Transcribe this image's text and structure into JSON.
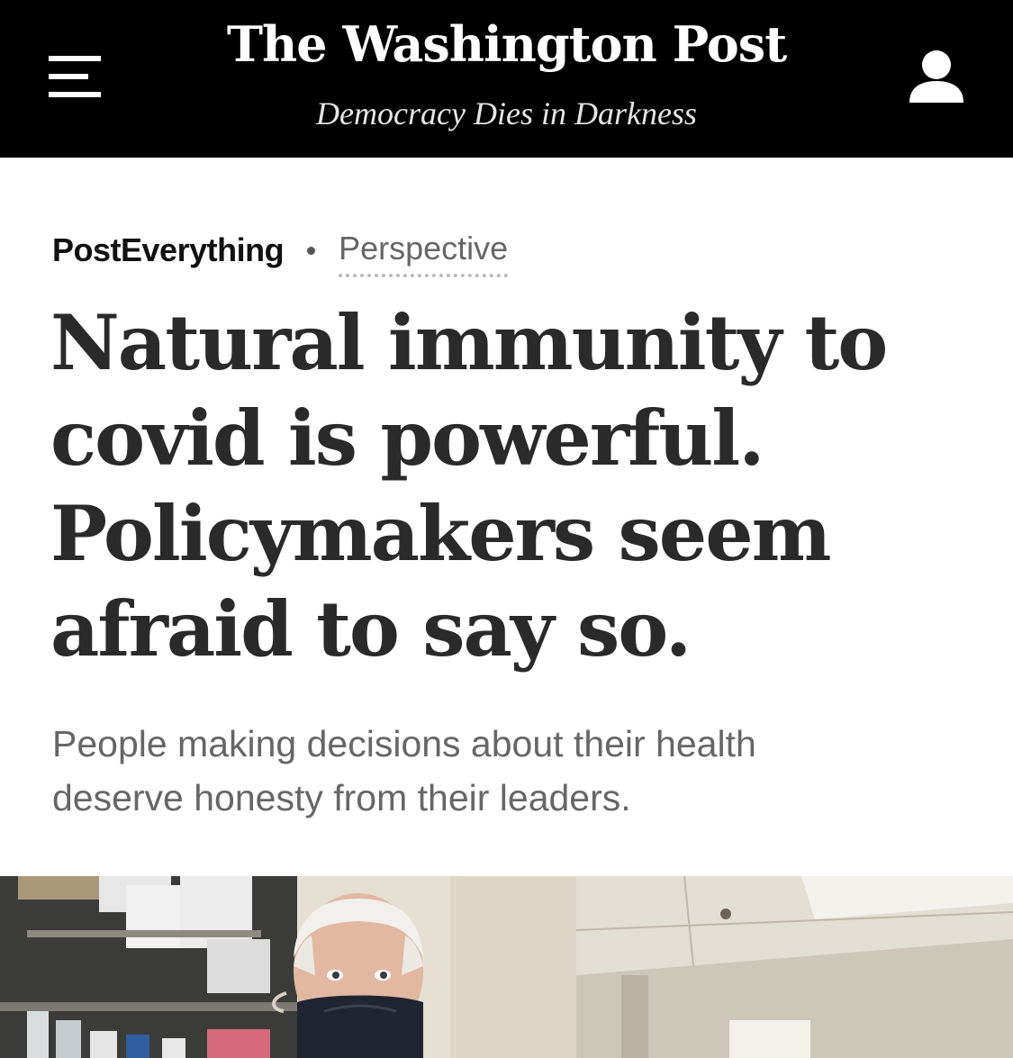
{
  "header": {
    "logo": "The Washington Post",
    "tagline": "Democracy Dies in Darkness",
    "menu_icon": "hamburger-menu-icon",
    "account_icon": "user-account-icon"
  },
  "article": {
    "section": "PostEverything",
    "label": "Perspective",
    "headline_lines": [
      "Natural immunity to",
      "covid is powerful.",
      "Policymakers seem",
      "afraid to say so."
    ],
    "subheadline_lines": [
      "People making decisions about their health",
      "deserve honesty from their leaders."
    ]
  },
  "colors": {
    "masthead_bg": "#000000",
    "headline": "#2a2a2a",
    "subheadline": "#666666"
  }
}
